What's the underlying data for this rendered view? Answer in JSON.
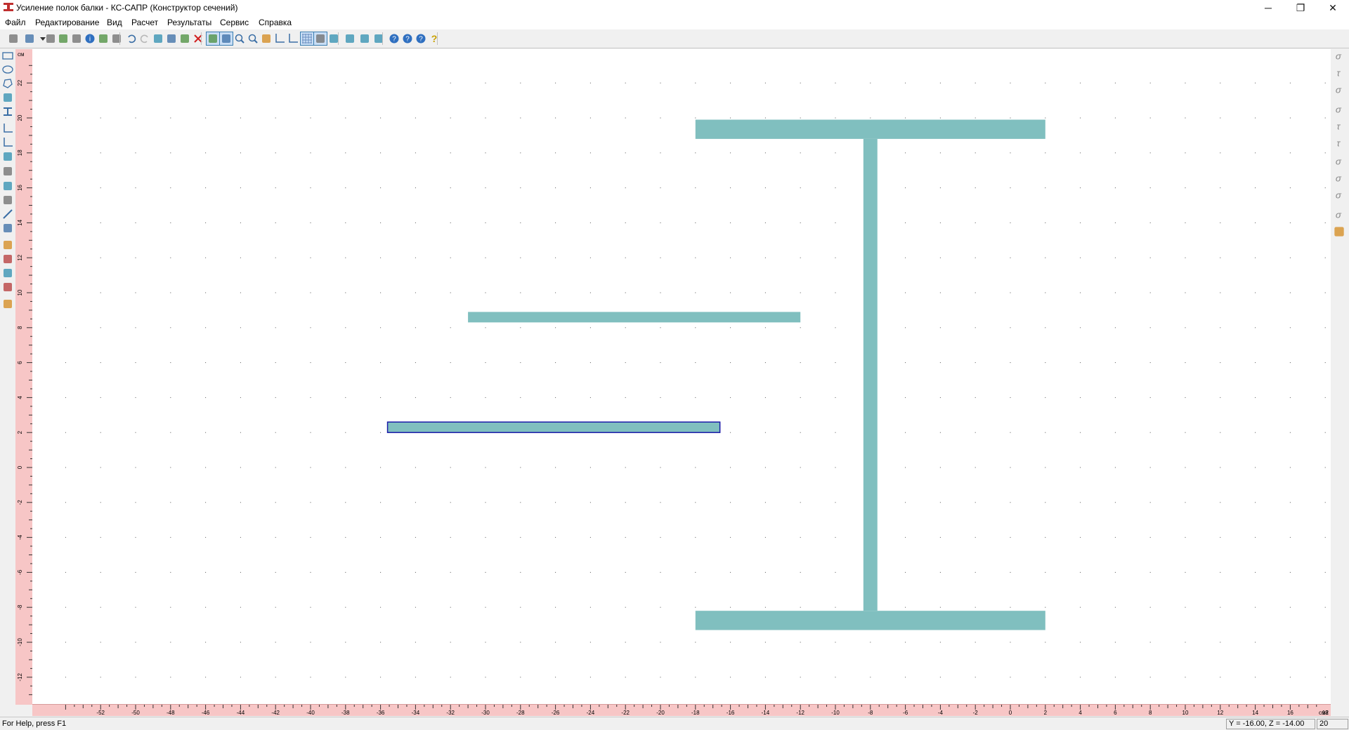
{
  "window": {
    "title": "Усиление полок балки - КС-САПР (Конструктор сечений)",
    "controls": {
      "minimize": "─",
      "restore": "❐",
      "close": "✕"
    }
  },
  "menu": [
    "Файл",
    "Редактирование",
    "Вид",
    "Расчет",
    "Результаты",
    "Сервис",
    "Справка"
  ],
  "toolbar": {
    "buttons": [
      {
        "name": "new-icon"
      },
      {
        "name": "open-icon"
      },
      {
        "name": "dropdown-arrow-icon"
      },
      {
        "name": "save-icon"
      },
      {
        "name": "save-all-icon"
      },
      {
        "name": "export-icon"
      },
      {
        "name": "info-icon"
      },
      {
        "name": "print-icon"
      },
      {
        "name": "print-preview-icon"
      },
      {
        "name": "undo-icon"
      },
      {
        "name": "redo-icon"
      },
      {
        "name": "cut-icon"
      },
      {
        "name": "copy-icon"
      },
      {
        "name": "paste-icon"
      },
      {
        "name": "delete-icon"
      },
      {
        "name": "fill-mode-icon",
        "active": true
      },
      {
        "name": "color-mode-icon",
        "active": true
      },
      {
        "name": "zoom-icon"
      },
      {
        "name": "zoom-window-icon"
      },
      {
        "name": "page-icon"
      },
      {
        "name": "dimension-icon"
      },
      {
        "name": "axes-icon"
      },
      {
        "name": "grid-icon",
        "active": true
      },
      {
        "name": "snap-icon",
        "active": true
      },
      {
        "name": "snap-points-icon"
      },
      {
        "name": "hand-icon"
      },
      {
        "name": "binoculars-icon"
      },
      {
        "name": "calculate-icon"
      },
      {
        "name": "help-icon"
      },
      {
        "name": "context-help-icon"
      },
      {
        "name": "about-icon"
      },
      {
        "name": "tips-icon"
      }
    ]
  },
  "left_tools": [
    "rectangle-tool-icon",
    "ellipse-tool-icon",
    "polygon-tool-icon",
    "pin-tool-icon",
    "i-beam-tool-icon",
    "axes-tool-icon",
    "coordinate-tool-icon",
    "mirror-tool-icon",
    "rotate-tool-icon",
    "nodes-tool-icon",
    "array-tool-icon",
    "line-tool-icon",
    "measure-tool-icon",
    "layer-up-icon",
    "layer-down-icon",
    "group-icon",
    "ungroup-icon",
    "properties-icon"
  ],
  "right_tools": [
    "sigma-icon",
    "tau-icon",
    "stress-icon",
    "sigma-1-icon",
    "tau-xy-icon",
    "tau-xz-icon",
    "sigma-2-icon",
    "sigma-3-icon",
    "sigma-e-icon",
    "sigma-r-icon",
    "chart-icon"
  ],
  "ruler": {
    "unit_label": "см",
    "y_ticks": [
      "22",
      "20",
      "18",
      "16",
      "14",
      "12",
      "10",
      "8",
      "6",
      "4",
      "2",
      "0",
      "-2",
      "-4",
      "-6",
      "-8",
      "-10",
      "-12"
    ],
    "x_ticks": [
      "-52",
      "-50",
      "-48",
      "-46",
      "-44",
      "-42",
      "-40",
      "-38",
      "-36",
      "-34",
      "-32",
      "-30",
      "-28",
      "-26",
      "-24",
      "-22",
      "-20",
      "-18",
      "-16",
      "-14",
      "-12",
      "-10",
      "-8",
      "-6",
      "-4",
      "-2",
      "0",
      "2",
      "4",
      "6",
      "8",
      "10",
      "12",
      "14",
      "16",
      "18",
      "см2"
    ]
  },
  "shapes": {
    "fill_color": "#80bfbf",
    "selected_stroke": "#1a1aa8",
    "items": [
      {
        "name": "i-beam-top-flange",
        "x": [
          -18,
          2
        ],
        "y": [
          18.8,
          19.9
        ]
      },
      {
        "name": "i-beam-web",
        "x": [
          -8.4,
          -7.6
        ],
        "y": [
          -8.2,
          18.8
        ]
      },
      {
        "name": "i-beam-bottom-flange",
        "x": [
          -18,
          2
        ],
        "y": [
          -9.3,
          -8.2
        ]
      },
      {
        "name": "reinforcement-plate-upper",
        "x": [
          -31,
          -12
        ],
        "y": [
          8.3,
          8.9
        ]
      },
      {
        "name": "reinforcement-plate-lower",
        "x": [
          -35.6,
          -16.6
        ],
        "y": [
          2.0,
          2.6
        ],
        "selected": true
      }
    ]
  },
  "status": {
    "help": "For Help, press F1",
    "coords": "Y = -16.00, Z = -14.00",
    "zoom": "20"
  }
}
